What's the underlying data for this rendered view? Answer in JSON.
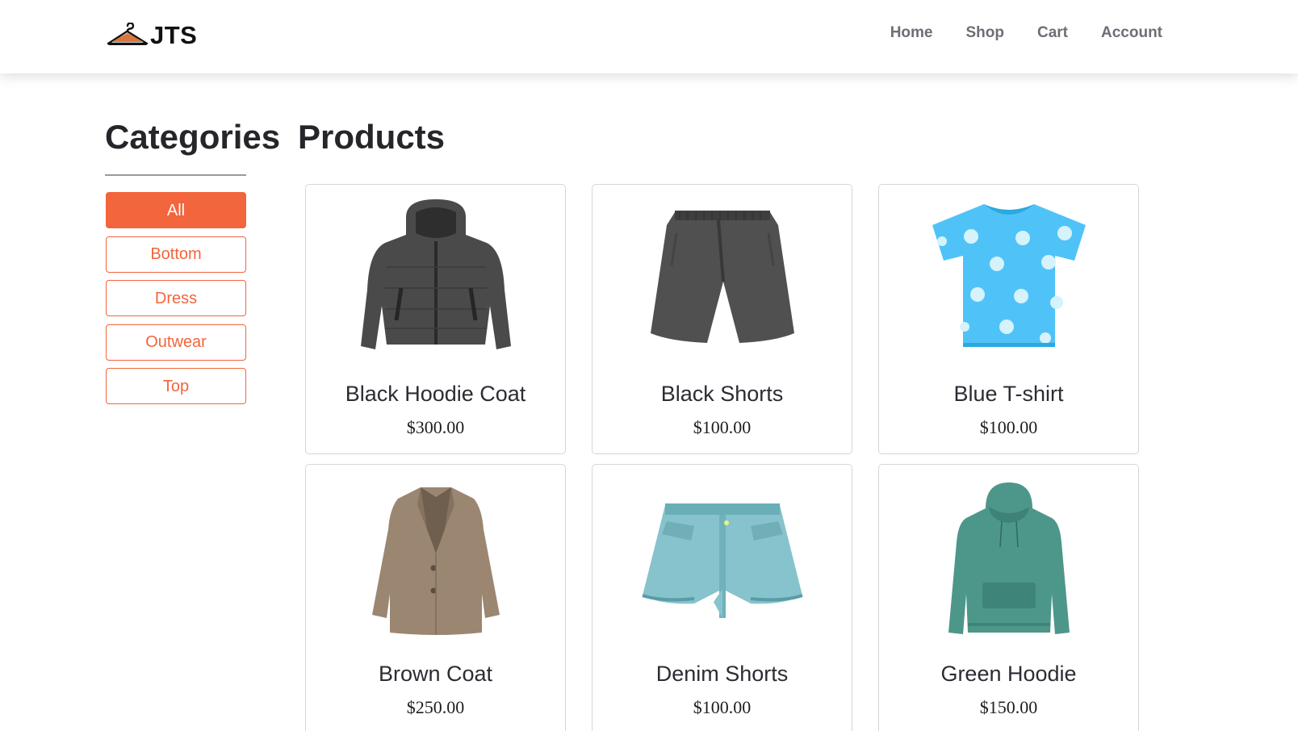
{
  "brand": {
    "name": "JTS",
    "icon": "hanger-icon"
  },
  "nav": {
    "links": [
      "Home",
      "Shop",
      "Cart",
      "Account"
    ]
  },
  "sidebar": {
    "title": "Categories",
    "items": [
      "All",
      "Bottom",
      "Dress",
      "Outwear",
      "Top"
    ],
    "active": "All"
  },
  "products": {
    "title": "Products",
    "items": [
      {
        "name": "Black Hoodie Coat",
        "price": "$300.00",
        "image": "black-hoodie-coat-image"
      },
      {
        "name": "Black Shorts",
        "price": "$100.00",
        "image": "black-shorts-image"
      },
      {
        "name": "Blue T-shirt",
        "price": "$100.00",
        "image": "blue-tshirt-image"
      },
      {
        "name": "Brown Coat",
        "price": "$250.00",
        "image": "brown-coat-image"
      },
      {
        "name": "Denim Shorts",
        "price": "$100.00",
        "image": "denim-shorts-image"
      },
      {
        "name": "Green Hoodie",
        "price": "$150.00",
        "image": "green-hoodie-image"
      }
    ]
  },
  "colors": {
    "accent": "#f2653d",
    "nav_text": "#6c6f76",
    "text": "#25262a"
  }
}
